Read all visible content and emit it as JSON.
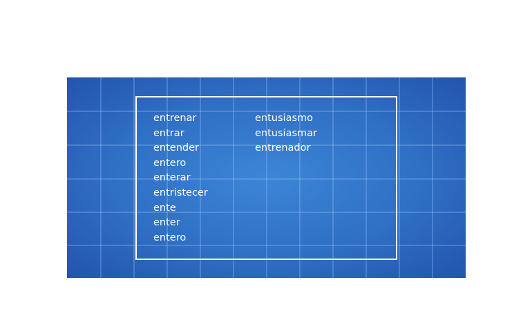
{
  "word_columns": [
    {
      "words": [
        "entrenar",
        "entrar",
        "entender",
        "entero",
        "enterar",
        "entristecer",
        "ente",
        "enter",
        "entero"
      ]
    },
    {
      "words": [
        "entusiasmo",
        "entusiasmar",
        "entrenador"
      ]
    }
  ],
  "colors": {
    "board_center": "#3c86d6",
    "board_edge": "#2354ac",
    "grid_line": "#96bef0",
    "frame": "#ffffff",
    "text": "#ffffff"
  }
}
